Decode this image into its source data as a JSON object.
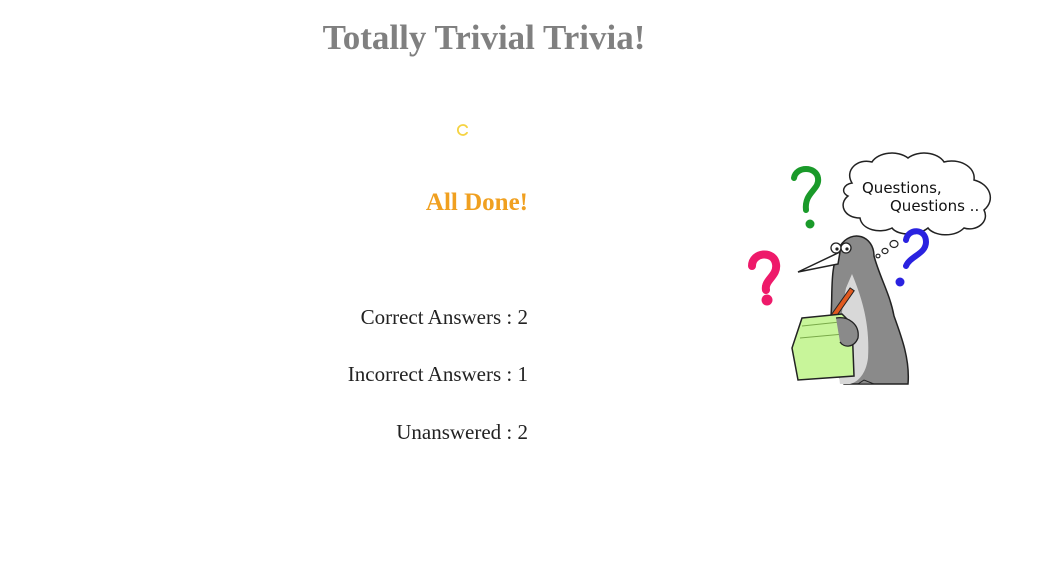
{
  "header": {
    "title": "Totally Trivial Trivia!"
  },
  "loading": {
    "icon": "loading-spinner-icon",
    "color": "#f5d342"
  },
  "results": {
    "heading": "All Done!",
    "heading_color": "#f0a020",
    "correct_label": "Correct Answers : 2",
    "incorrect_label": "Incorrect Answers : 1",
    "unanswered_label": "Unanswered : 2"
  },
  "illustration": {
    "name": "penguin-with-questions-illustration",
    "bubble_line1": "Questions,",
    "bubble_line2": "Questions .."
  }
}
